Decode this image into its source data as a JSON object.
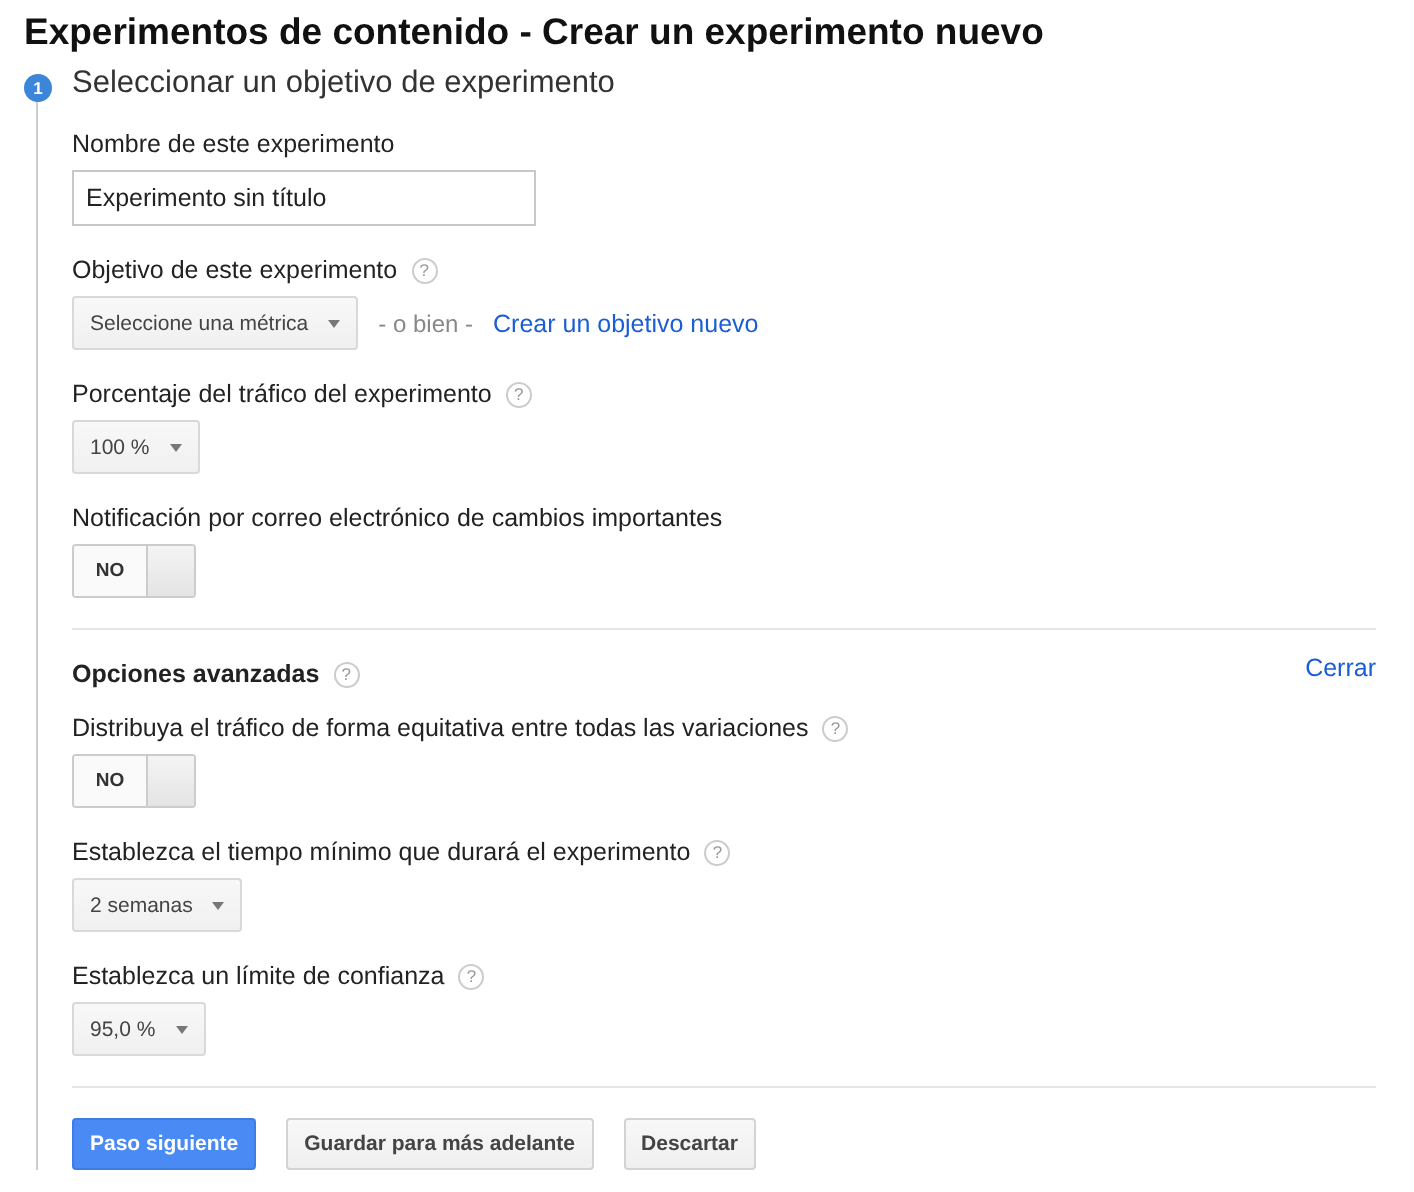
{
  "title": "Experimentos de contenido - Crear un experimento nuevo",
  "step": {
    "number": "1",
    "title": "Seleccionar un objetivo de experimento"
  },
  "fields": [
    {
      "kind": "text",
      "label": "Nombre de este experimento",
      "value": "Experimento sin título"
    },
    {
      "kind": "select",
      "label": "Objetivo de este experimento",
      "help": "?",
      "value": "Seleccione una métrica",
      "separator": "- o bien -",
      "link": "Crear un objetivo nuevo"
    },
    {
      "kind": "select",
      "label": "Porcentaje del tráfico del experimento",
      "help": "?",
      "value": "100 %"
    },
    {
      "kind": "toggle",
      "label": "Notificación por correo electrónico de cambios importantes",
      "on": false,
      "state_label": "NO"
    }
  ],
  "advanced": {
    "title": "Opciones avanzadas",
    "help": "?",
    "close": "Cerrar",
    "fields": [
      {
        "kind": "toggle",
        "label": "Distribuya el tráfico de forma equitativa entre todas las variaciones",
        "help": "?",
        "on": false,
        "state_label": "NO"
      },
      {
        "kind": "select",
        "label": "Establezca el tiempo mínimo que durará el experimento",
        "help": "?",
        "value": "2 semanas"
      },
      {
        "kind": "select",
        "label": "Establezca un límite de confianza",
        "help": "?",
        "value": "95,0 %"
      }
    ]
  },
  "buttons": [
    {
      "label": "Paso siguiente",
      "primary": true
    },
    {
      "label": "Guardar para más adelante",
      "primary": false
    },
    {
      "label": "Descartar",
      "primary": false
    }
  ]
}
